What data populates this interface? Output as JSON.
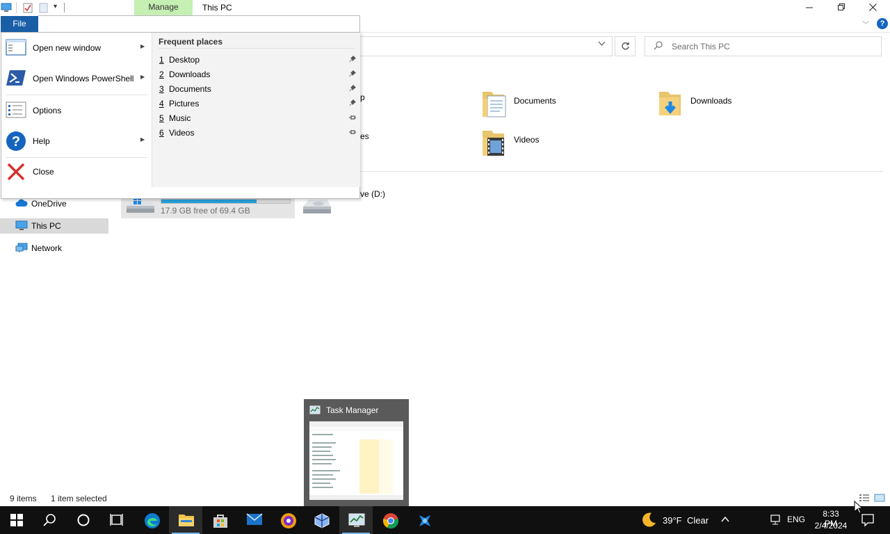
{
  "window": {
    "context_tab": "Manage",
    "title": "This PC"
  },
  "file_tab": {
    "label": "File"
  },
  "file_menu": {
    "items": [
      {
        "label": "Open new window",
        "has_submenu": true
      },
      {
        "label": "Open Windows PowerShell",
        "has_submenu": true
      },
      {
        "label": "Options",
        "has_submenu": false
      },
      {
        "label": "Help",
        "has_submenu": true
      },
      {
        "label": "Close",
        "has_submenu": false
      }
    ],
    "frequent_title": "Frequent places",
    "frequent_places": [
      {
        "num": "1",
        "label": "Desktop",
        "pinned": true
      },
      {
        "num": "2",
        "label": "Downloads",
        "pinned": true
      },
      {
        "num": "3",
        "label": "Documents",
        "pinned": true
      },
      {
        "num": "4",
        "label": "Pictures",
        "pinned": true
      },
      {
        "num": "5",
        "label": "Music",
        "pinned": false
      },
      {
        "num": "6",
        "label": "Videos",
        "pinned": false
      }
    ]
  },
  "search": {
    "placeholder": "Search This PC"
  },
  "folders": {
    "visible_fragments": [
      "p",
      "es"
    ],
    "items": [
      {
        "label": "Documents"
      },
      {
        "label": "Downloads"
      },
      {
        "label": "Videos"
      }
    ]
  },
  "drives": {
    "c_free": "17.9 GB free of 69.4 GB",
    "c_used_fraction": 0.74,
    "d_label_fragment": "ve (D:)"
  },
  "nav": {
    "items": [
      {
        "label": "OneDrive"
      },
      {
        "label": "This PC"
      },
      {
        "label": "Network"
      }
    ]
  },
  "status": {
    "items": "9 items",
    "selected": "1 item selected"
  },
  "task_manager_thumb": {
    "title": "Task Manager"
  },
  "taskbar": {
    "weather_temp": "39°F",
    "weather_desc": "Clear",
    "lang": "ENG",
    "time": "8:33 PM",
    "date": "2/4/2024"
  },
  "colors": {
    "accent": "#1a5ea8",
    "manage_tab": "#c6efb3",
    "drive_fill": "#26a0da",
    "taskbar": "#101010"
  }
}
